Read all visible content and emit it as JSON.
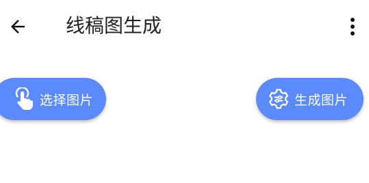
{
  "toolbar": {
    "title": "线稿图生成",
    "back_icon": "arrow-left-icon",
    "menu_icon": "more-vertical-icon"
  },
  "actions": {
    "select_image": {
      "label": "选择图片",
      "icon": "touch-hand-icon"
    },
    "generate_image": {
      "label": "生成图片",
      "icon": "settings-gear-icon"
    }
  },
  "colors": {
    "accent": "#5b8afc",
    "title_text": "#222222",
    "button_text": "#ffffff",
    "background": "#ffffff"
  }
}
